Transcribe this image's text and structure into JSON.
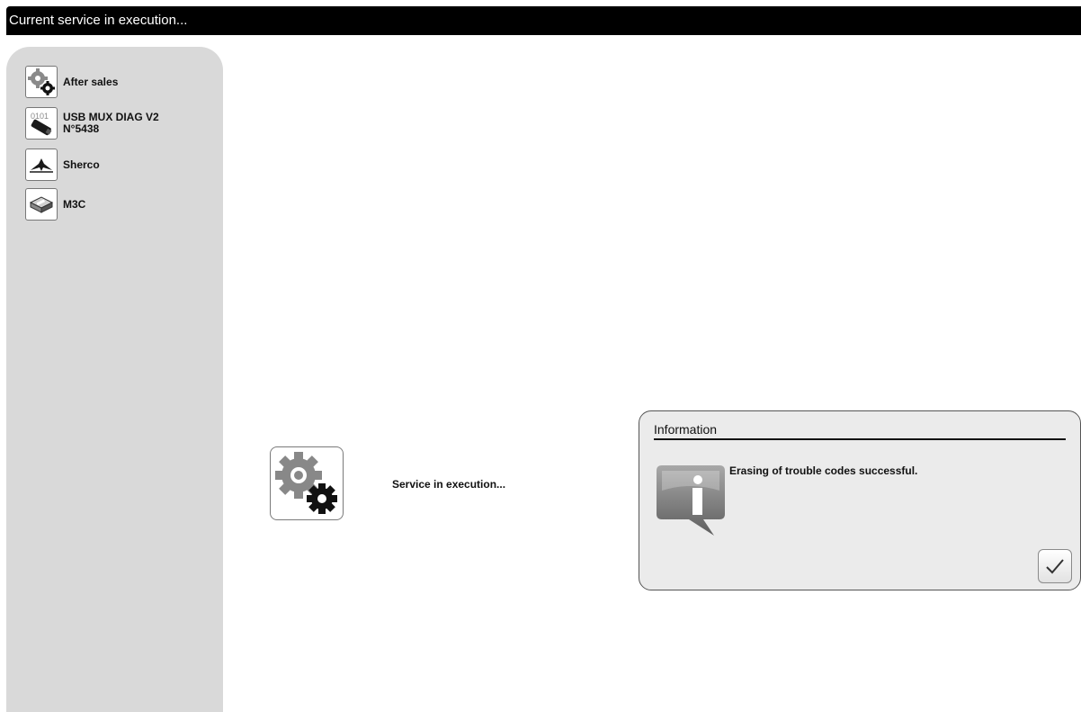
{
  "header": {
    "title": "Current service in execution..."
  },
  "sidebar": {
    "items": [
      {
        "label": "After sales",
        "sublabel": "",
        "icon": "gears-icon"
      },
      {
        "label": "USB MUX DIAG V2",
        "sublabel": "N°5438",
        "icon": "usb-interface-icon"
      },
      {
        "label": "Sherco",
        "sublabel": "",
        "icon": "sherco-logo-icon"
      },
      {
        "label": "M3C",
        "sublabel": "",
        "icon": "ecu-module-icon"
      }
    ]
  },
  "main": {
    "status_text": "Service in execution...",
    "status_icon": "gears-icon"
  },
  "dialog": {
    "title": "Information",
    "message": "Erasing of trouble codes successful.",
    "icon": "info-speech-bubble-icon",
    "confirm_icon": "checkmark-icon"
  },
  "colors": {
    "title_bar": "#000000",
    "sidebar": "#d9d9d9",
    "dialog_bg": "#ebebeb",
    "info_icon": "#7f7f7f"
  }
}
